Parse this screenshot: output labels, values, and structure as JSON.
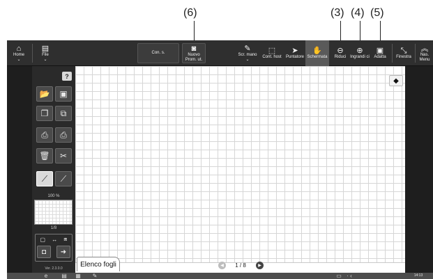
{
  "callouts": [
    "(6)",
    "(3)",
    "(4)",
    "(5)"
  ],
  "toolbar": {
    "home": {
      "label": "Home",
      "icon": "home-icon"
    },
    "file": {
      "label": "File",
      "icon": "file-icon"
    },
    "connect": {
      "label": "Con. s."
    },
    "new_prom": {
      "label": "Nuovo Prom. ut.",
      "icon": "camera-icon"
    },
    "scr_mano": {
      "label": "Scr. mano",
      "icon": "pen-icon"
    },
    "cont_host": {
      "label": "Cont. host",
      "icon": "cursor-screen-icon"
    },
    "puntatore": {
      "label": "Puntatore",
      "icon": "pointer-icon"
    },
    "schermata": {
      "label": "Schermata",
      "icon": "hand-icon"
    },
    "riduci": {
      "label": "Riduci",
      "icon": "zoom-out-icon"
    },
    "ingrandisci": {
      "label": "Ingrandi ci",
      "icon": "zoom-in-icon"
    },
    "adatta": {
      "label": "Adatta",
      "icon": "fit-icon"
    },
    "finestra": {
      "label": "Finestra",
      "icon": "window-icon"
    },
    "nasc_menu": {
      "label": "Nas. Menu",
      "icon": "collapse-icon"
    }
  },
  "left_panel": {
    "help": "?",
    "zoom": "100 %",
    "page_small": "1/8",
    "version": "Ver. 2.3.0.0"
  },
  "canvas": {
    "expand_glyph": "◆"
  },
  "sheet_tab": "Elenco fogli",
  "pager": {
    "text": "1 / 8",
    "prev": "◀",
    "next": "▶"
  },
  "taskbar": {
    "time": "14:13"
  },
  "colors": {
    "toolbar": "#2f2f2f",
    "panel": "#2a2a2a",
    "grid": "#d6d6d6"
  }
}
